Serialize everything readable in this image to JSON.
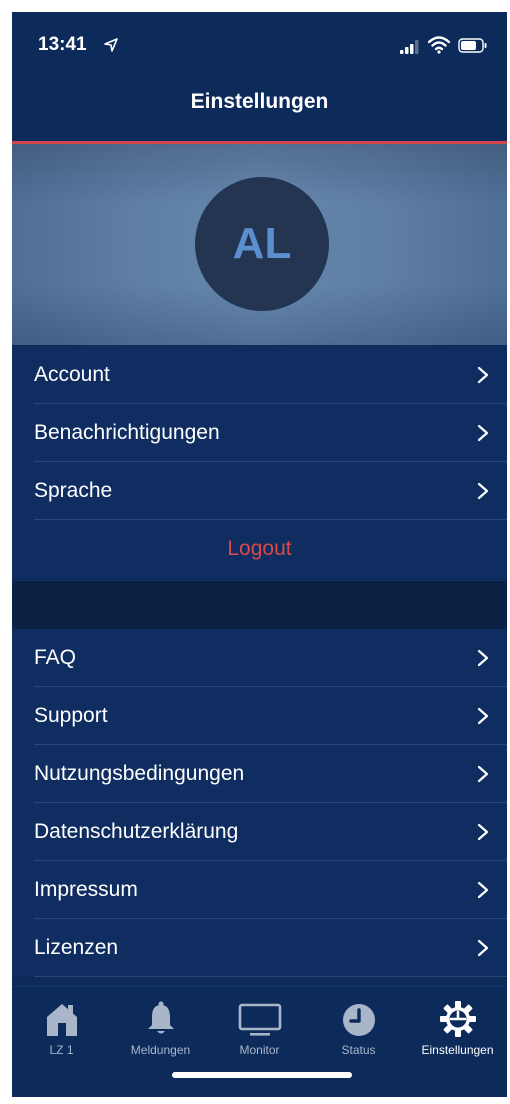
{
  "status_bar": {
    "time": "13:41"
  },
  "header": {
    "title": "Einstellungen"
  },
  "profile": {
    "initials": "AL"
  },
  "settings_section": {
    "items": [
      {
        "label": "Account"
      },
      {
        "label": "Benachrichtigungen"
      },
      {
        "label": "Sprache"
      }
    ],
    "logout_label": "Logout"
  },
  "info_section": {
    "items": [
      {
        "label": "FAQ"
      },
      {
        "label": "Support"
      },
      {
        "label": "Nutzungsbedingungen"
      },
      {
        "label": "Datenschutzerklärung"
      },
      {
        "label": "Impressum"
      },
      {
        "label": "Lizenzen"
      }
    ]
  },
  "tabbar": {
    "tabs": [
      {
        "label": "LZ 1",
        "icon": "house-icon"
      },
      {
        "label": "Meldungen",
        "icon": "bell-icon"
      },
      {
        "label": "Monitor",
        "icon": "monitor-icon"
      },
      {
        "label": "Status",
        "icon": "clock-icon"
      },
      {
        "label": "Einstellungen",
        "icon": "gear-icon",
        "active": true
      }
    ]
  },
  "colors": {
    "background": "#0c2b5b",
    "row_background": "#0f2d60",
    "accent_line": "#d2464b",
    "logout_text": "#d94a4a",
    "avatar_background": "#243552",
    "avatar_text": "#5b8fd0",
    "tab_inactive": "#a9b6c9",
    "tab_active": "#ffffff"
  }
}
